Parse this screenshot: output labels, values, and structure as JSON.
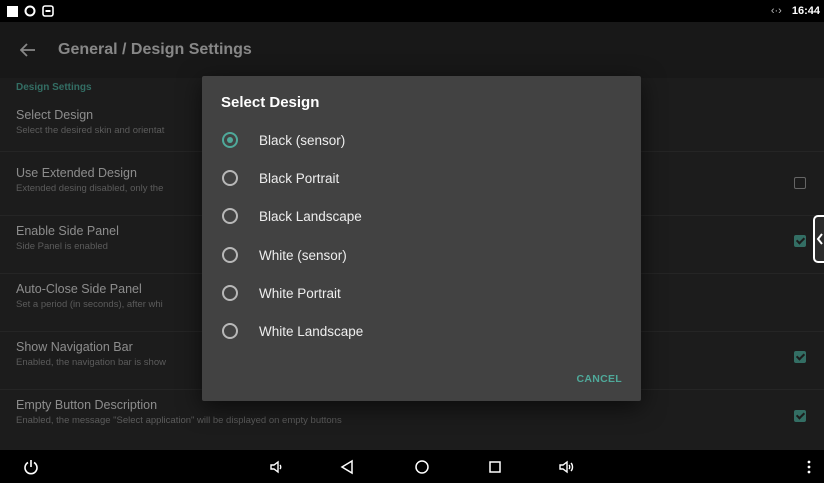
{
  "status_bar": {
    "time": "16:44",
    "vpn_indicator": "‹·›",
    "left_icons": [
      "square-notification-icon",
      "circle-notification-icon",
      "box-notification-icon"
    ]
  },
  "app_bar": {
    "title": "General / Design Settings",
    "back_icon": "arrow-left-icon"
  },
  "settings": {
    "section_header": "Design Settings",
    "items": [
      {
        "title": "Select Design",
        "summary": "Select the desired skin and orientat",
        "checkbox": null
      },
      {
        "title": "Use Extended Design",
        "summary": "Extended desing disabled, only the",
        "checkbox": false
      },
      {
        "title": "Enable Side Panel",
        "summary": "Side Panel is enabled",
        "checkbox": true
      },
      {
        "title": "Auto-Close Side Panel",
        "summary": "Set a period (in seconds), after whi",
        "checkbox": null
      },
      {
        "title": "Show Navigation Bar",
        "summary": "Enabled, the navigation bar is show",
        "checkbox": true
      },
      {
        "title": "Empty Button Description",
        "summary": "Enabled, the message \"Select application\" will be displayed on empty buttons",
        "checkbox": true
      }
    ]
  },
  "dialog": {
    "title": "Select Design",
    "options": [
      {
        "label": "Black (sensor)",
        "selected": true
      },
      {
        "label": "Black Portrait",
        "selected": false
      },
      {
        "label": "Black Landscape",
        "selected": false
      },
      {
        "label": "White (sensor)",
        "selected": false
      },
      {
        "label": "White Portrait",
        "selected": false
      },
      {
        "label": "White Landscape",
        "selected": false
      }
    ],
    "cancel_label": "CANCEL"
  },
  "nav_bar": {
    "icons": [
      "power-icon",
      "volume-down-icon",
      "back-triangle-icon",
      "home-circle-icon",
      "recents-square-icon",
      "volume-up-icon",
      "overflow-menu-icon"
    ]
  },
  "colors": {
    "accent": "#4fa99a",
    "background": "#2b2b2b",
    "dialog_background": "#424242"
  }
}
